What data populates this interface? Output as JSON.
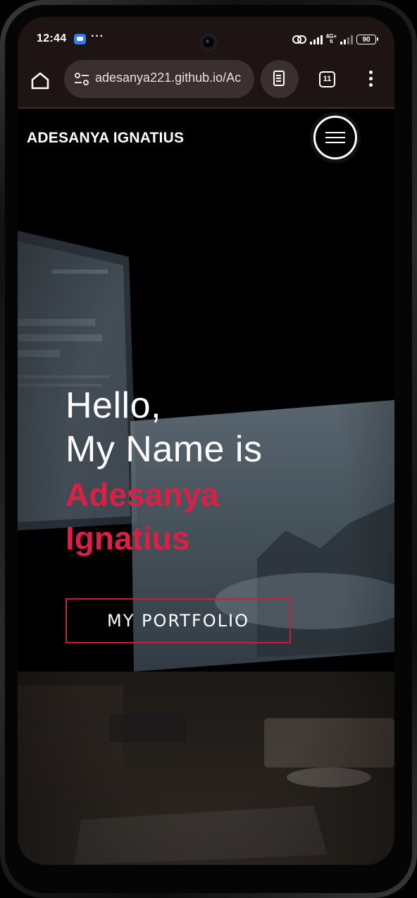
{
  "status_bar": {
    "time": "12:44",
    "more_label": "···",
    "network_label": "4G+",
    "battery": "90"
  },
  "browser": {
    "url": "adesanya221.github.io/Ac",
    "tab_count": "11"
  },
  "page": {
    "brand": "ADESANYA IGNATIUS",
    "greeting_line1": "Hello,",
    "greeting_line2": "My Name is",
    "name_line1": "Adesanya",
    "name_line2": "Ignatius",
    "cta_label": "MY PORTFOLIO",
    "accent_color": "#dd1e45"
  }
}
